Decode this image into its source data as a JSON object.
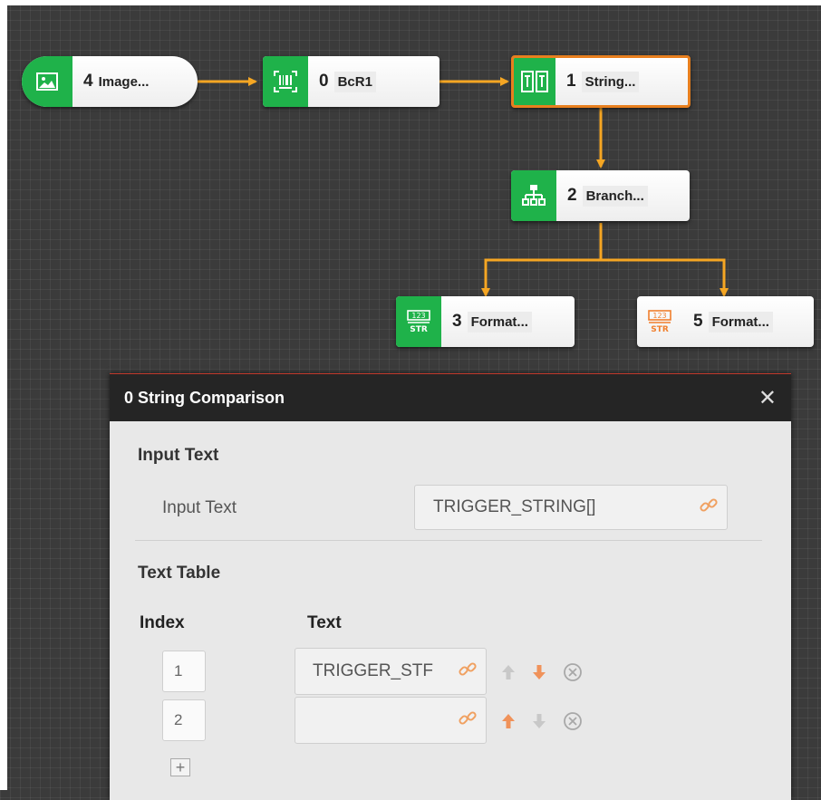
{
  "nodes": [
    {
      "id": "image",
      "num": "4",
      "name": "Image...",
      "icon": "image-icon"
    },
    {
      "id": "bcr",
      "num": "0",
      "name": "BcR1",
      "icon": "barcode-reader-icon"
    },
    {
      "id": "string",
      "num": "1",
      "name": "String...",
      "icon": "string-compare-icon"
    },
    {
      "id": "branch",
      "num": "2",
      "name": "Branch...",
      "icon": "branch-icon"
    },
    {
      "id": "format3",
      "num": "3",
      "name": "Format...",
      "icon": "format-string-icon"
    },
    {
      "id": "format5",
      "num": "5",
      "name": "Format...",
      "icon": "format-string-icon"
    }
  ],
  "dialog": {
    "title": "0 String Comparison",
    "close": "✕",
    "input_section": "Input Text",
    "input_label": "Input Text",
    "input_value": "TRIGGER_STRING[]",
    "table_section": "Text Table",
    "col_index": "Index",
    "col_text": "Text",
    "rows": [
      {
        "index": "1",
        "text": "TRIGGER_STF"
      },
      {
        "index": "2",
        "text": ""
      }
    ],
    "add_label": "+"
  },
  "colors": {
    "node_green": "#1fb24a",
    "connector_orange": "#f5a623",
    "selected_border": "#e87f1e",
    "arrow_orange": "#f0925a",
    "arrow_gray": "#c8c8c8"
  }
}
